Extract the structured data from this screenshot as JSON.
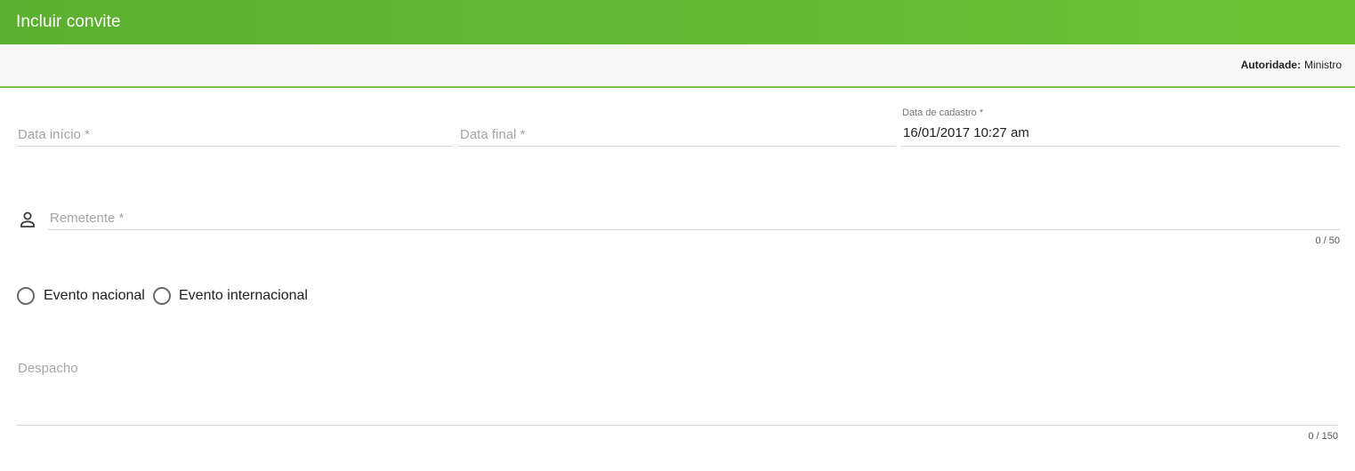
{
  "header": {
    "title": "Incluir convite"
  },
  "subbar": {
    "authority_label": "Autoridade:",
    "authority_value": "Ministro"
  },
  "form": {
    "data_inicio": {
      "placeholder": "Data início *"
    },
    "data_final": {
      "placeholder": "Data final *"
    },
    "data_cadastro": {
      "label": "Data de cadastro *",
      "value": "16/01/2017 10:27 am"
    },
    "remetente": {
      "placeholder": "Remetente *",
      "counter": "0 / 50",
      "icon": "person-icon"
    },
    "tipo_evento": {
      "options": [
        "Evento nacional",
        "Evento internacional"
      ]
    },
    "despacho": {
      "placeholder": "Despacho",
      "counter": "0 / 150"
    }
  },
  "colors": {
    "header_start": "#5caf30",
    "header_end": "#6cc232",
    "accent_line": "#7cbf4b"
  }
}
